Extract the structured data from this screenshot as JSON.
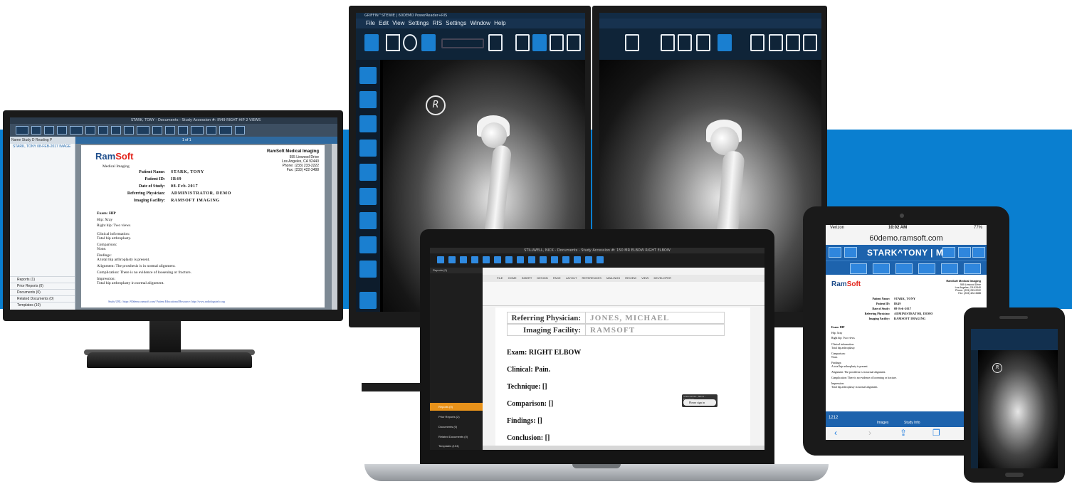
{
  "left_monitor": {
    "window_title": "STARK, TONY - Documents - Study Accession #: IR49 RIGHT HIP 2 VIEWS",
    "sidebar_header": "Name   Study D   Reading P",
    "sidebar_row": "STARK, TONY   08-FEB-2017   IMAGE",
    "sidebar_footer": [
      "Reports (1)",
      "Prior Reports (0)",
      "Documents (0)",
      "Related Documents (0)",
      "Templates (10)"
    ],
    "page_indicator": "1 of 1",
    "facility_name": "RamSoft Medical Imaging",
    "facility_address": [
      "555 Linwood Drive",
      "Los Angeles, CA 92440",
      "Phone: (233) 233-2222",
      "Fax: (233) 422-3488"
    ],
    "doc_title": "Medical Imaging",
    "fields": [
      {
        "label": "Patient Name:",
        "value": "STARK, TONY"
      },
      {
        "label": "Patient ID:",
        "value": "IR49"
      },
      {
        "label": "Date of Study:",
        "value": "08-Feb-2017"
      },
      {
        "label": "Referring Physician:",
        "value": "ADMINISTRATOR, DEMO"
      },
      {
        "label": "Imaging Facility:",
        "value": "RAMSOFT IMAGING"
      }
    ],
    "exam": "Exam: HIP",
    "hip_line": "Hip: Xray",
    "right_hip": "Right hip:     Two views",
    "clinical_head": "Clinical information:",
    "clinical_text": "Total hip arthroplasty.",
    "comparison_head": "Comparison:",
    "comparison_text": "None.",
    "findings_head": "Findings:",
    "findings_text": "A total hip arthroplasty is present.",
    "alignment": "Alignment: The prosthesis is in normal alignment.",
    "complication": "Complication: There is no evidence of loosening or fracture.",
    "impression_head": "Impression:",
    "impression_text": "Total hip arthroplasty in normal alignment.",
    "link_text": "Study URL: https://60demo.ramsoft.com/   Patient Educational Resource: http://www.radiologyinfo.org"
  },
  "powerreader": {
    "window_title": "GRIFFIN^STEWIE | 60DEMO PowerReader+RIS",
    "menu": [
      "File",
      "Edit",
      "View",
      "Settings",
      "RIS Settings",
      "Window",
      "Help"
    ],
    "r_marker": "R"
  },
  "laptop": {
    "window_title": "STILLWELL, NICK - Documents - Study Accession #: 150 MR ELBOW RIGHT ELBOW",
    "nav_header": "Reports (0)",
    "nav_items": [
      "Reports (0)",
      "Prior Reports (2)",
      "Documents (0)",
      "Related Documents (0)",
      "Templates (104)"
    ],
    "ribbon_tabs": [
      "FILE",
      "HOME",
      "INSERT",
      "DESIGN",
      "PAGE LAYOUT",
      "REFERENCES",
      "MAILINGS",
      "REVIEW",
      "VIEW",
      "DEVELOPER"
    ],
    "doc_rows": [
      {
        "label": "Referring Physician:",
        "value": "JONES, MICHAEL"
      },
      {
        "label": "Imaging Facility:",
        "value": "RAMSOFT"
      }
    ],
    "exam_label": "Exam:",
    "exam_value": "RIGHT ELBOW",
    "lines": [
      "Clinical: Pain.",
      "Technique: []",
      "Comparison: []",
      "Findings: []",
      "Conclusion: []"
    ],
    "sign_popup_title": "STILLWELL, NICK - Document",
    "sign_button": "Please sign in"
  },
  "tablet": {
    "carrier": "Verizon",
    "time": "10:02 AM",
    "battery": "77%",
    "url": "60demo.ramsoft.com",
    "patient_title": "STARK^TONY | M...",
    "facility_name": "RamSoft Medical Imaging",
    "facility_address": [
      "555 Linwood Drive",
      "Los Angeles, CA 92440",
      "Phone: (233) 233-2222",
      "Fax: (233) 422-3488"
    ],
    "fields": [
      {
        "label": "Patient Name:",
        "value": "STARK, TONY"
      },
      {
        "label": "Patient ID:",
        "value": "IR49"
      },
      {
        "label": "Date of Study:",
        "value": "08-Feb-2017"
      },
      {
        "label": "Referring Physician:",
        "value": "ADMINISTRATOR, DEMO"
      },
      {
        "label": "Imaging Facility:",
        "value": "RAMSOFT IMAGING"
      }
    ],
    "exam": "Exam: HIP",
    "hip_line": "Hip: Xray",
    "right_hip": "Right hip:    Two views",
    "clinical": "Clinical information:",
    "clinical_text": "Total hip arthroplasty.",
    "comparison": "Comparison:",
    "comparison_text": "None.",
    "findings": "Findings:",
    "findings_text": "A total hip arthroplasty is present.",
    "alignment": "Alignment: The prosthesis is in normal alignment.",
    "complication": "Complication: There is no evidence of loosening or fracture.",
    "impression": "Impression:",
    "impression_text": "Total hip arthroplasty in normal alignment.",
    "footer_number": "1212",
    "footer_images": "Images",
    "footer_study_info": "Study Info"
  },
  "logo": {
    "ram": "Ram",
    "soft": "Soft"
  },
  "colors": {
    "band": "#0a7fd0",
    "accent": "#1a7fd0",
    "ramsoft_blue": "#1f4e8c",
    "ramsoft_red": "#e2231a"
  }
}
